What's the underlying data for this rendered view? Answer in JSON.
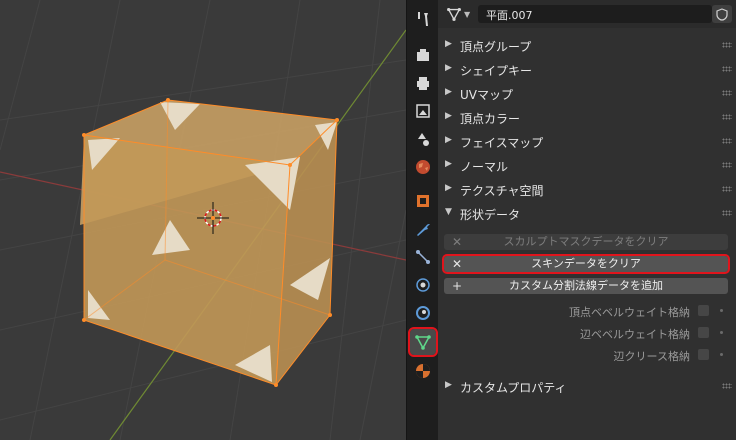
{
  "header": {
    "mesh_name": "平面.007"
  },
  "tabs": [
    {
      "icon": "wrench-screwdriver-icon",
      "name": "tab-tool"
    },
    {
      "icon": "render-camera-icon",
      "name": "tab-render"
    },
    {
      "icon": "printer-icon",
      "name": "tab-output"
    },
    {
      "icon": "image-icon",
      "name": "tab-view-layer"
    },
    {
      "icon": "scene-shapes-icon",
      "name": "tab-scene"
    },
    {
      "icon": "world-globe-icon",
      "name": "tab-world"
    },
    {
      "icon": "object-square-icon",
      "name": "tab-object"
    },
    {
      "icon": "wrench-icon",
      "name": "tab-modifiers"
    },
    {
      "icon": "particles-icon",
      "name": "tab-particles"
    },
    {
      "icon": "physics-orbit-icon",
      "name": "tab-physics"
    },
    {
      "icon": "constraints-icon",
      "name": "tab-constraints"
    },
    {
      "icon": "mesh-data-triangle-icon",
      "name": "tab-data"
    },
    {
      "icon": "material-sphere-icon",
      "name": "tab-material"
    }
  ],
  "sections": [
    {
      "label": "頂点グループ",
      "expanded": false
    },
    {
      "label": "シェイプキー",
      "expanded": false
    },
    {
      "label": "UVマップ",
      "expanded": false
    },
    {
      "label": "頂点カラー",
      "expanded": false
    },
    {
      "label": "フェイスマップ",
      "expanded": false
    },
    {
      "label": "ノーマル",
      "expanded": false
    },
    {
      "label": "テクスチャ空間",
      "expanded": false
    },
    {
      "label": "形状データ",
      "expanded": true
    }
  ],
  "geometry_data": {
    "clear_sculpt_mask": "スカルプトマスクデータをクリア",
    "clear_skin": "スキンデータをクリア",
    "add_custom_normals": "カスタム分割法線データを追加",
    "store_vertex_bevel": "頂点ベベルウェイト格納",
    "store_edge_bevel": "辺ベベルウェイト格納",
    "store_edge_crease": "辺クリース格納"
  },
  "custom_properties": {
    "label": "カスタムプロパティ",
    "expanded": false
  },
  "colors": {
    "accent": "#e0141c",
    "mesh_face": "#c8a064",
    "mesh_edge": "#ff8c28"
  }
}
